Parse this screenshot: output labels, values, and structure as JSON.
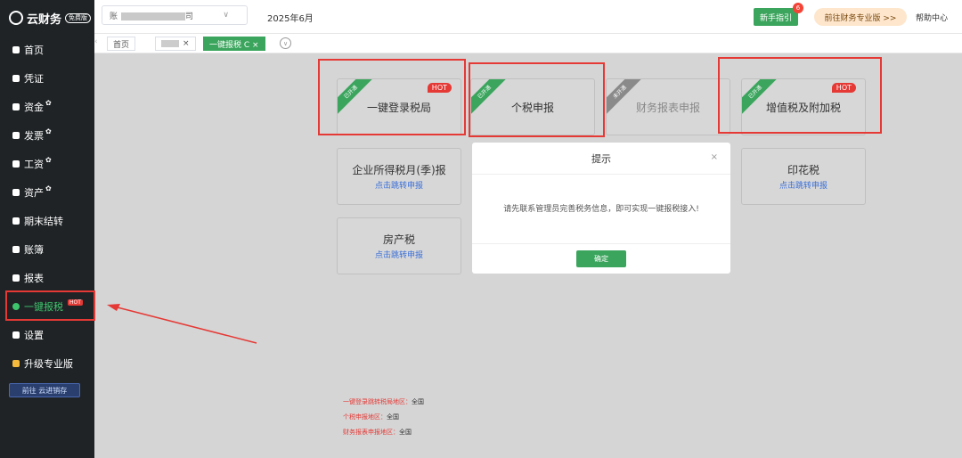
{
  "sidebar": {
    "logo_text": "云财务",
    "logo_badge": "免费版",
    "items": [
      {
        "label": "首页",
        "icon": "home-icon"
      },
      {
        "label": "凭证",
        "icon": "voucher-icon"
      },
      {
        "label": "资金",
        "icon": "fund-icon",
        "mark": "✿"
      },
      {
        "label": "发票",
        "icon": "invoice-icon",
        "mark": "✿"
      },
      {
        "label": "工资",
        "icon": "salary-icon",
        "mark": "✿"
      },
      {
        "label": "资产",
        "icon": "asset-icon",
        "mark": "✿"
      },
      {
        "label": "期末结转",
        "icon": "period-close-icon"
      },
      {
        "label": "账簿",
        "icon": "ledger-icon"
      },
      {
        "label": "报表",
        "icon": "report-icon"
      },
      {
        "label": "一键报税",
        "icon": "tax-icon",
        "badge": "HOT"
      },
      {
        "label": "设置",
        "icon": "settings-icon"
      },
      {
        "label": "升级专业版",
        "icon": "crown-icon"
      }
    ],
    "promo": "前往 云进销存"
  },
  "topbar": {
    "company_prefix": "账",
    "company_suffix": "司",
    "period": "2025年6月",
    "guide_label": "新手指引",
    "guide_badge": "6",
    "pro_label": "前往财务专业版 >>",
    "help_label": "帮助中心"
  },
  "tabs": {
    "home": "首页",
    "active": "一键报税 C ×",
    "close": "×"
  },
  "cards": {
    "login_bureau": {
      "title": "一键登录税局",
      "ribbon": "已开通",
      "hot": "HOT"
    },
    "personal_tax": {
      "title": "个税申报",
      "ribbon": "已开通"
    },
    "financial_report": {
      "title": "财务报表申报",
      "ribbon": "未开通"
    },
    "vat": {
      "title": "增值税及附加税",
      "ribbon": "已开通",
      "hot": "HOT"
    },
    "cit": {
      "title": "企业所得税月(季)报",
      "link": "点击跳转申报"
    },
    "stamp": {
      "title": "印花税",
      "link": "点击跳转申报"
    },
    "property": {
      "title": "房产税",
      "link": "点击跳转申报"
    }
  },
  "modal": {
    "title": "提示",
    "close": "×",
    "message": "请先联系管理员完善税务信息，即可实现一键报税接入!",
    "ok_label": "确定"
  },
  "notes": [
    {
      "label": "一键登录跳转税局地区：",
      "value": "全国"
    },
    {
      "label": "个税申报地区：",
      "value": "全国"
    },
    {
      "label": "财务报表申报地区：",
      "value": "全国"
    }
  ],
  "colors": {
    "accent": "#3ba55d",
    "annotation": "#e53935",
    "sidebar": "#1f2326"
  }
}
